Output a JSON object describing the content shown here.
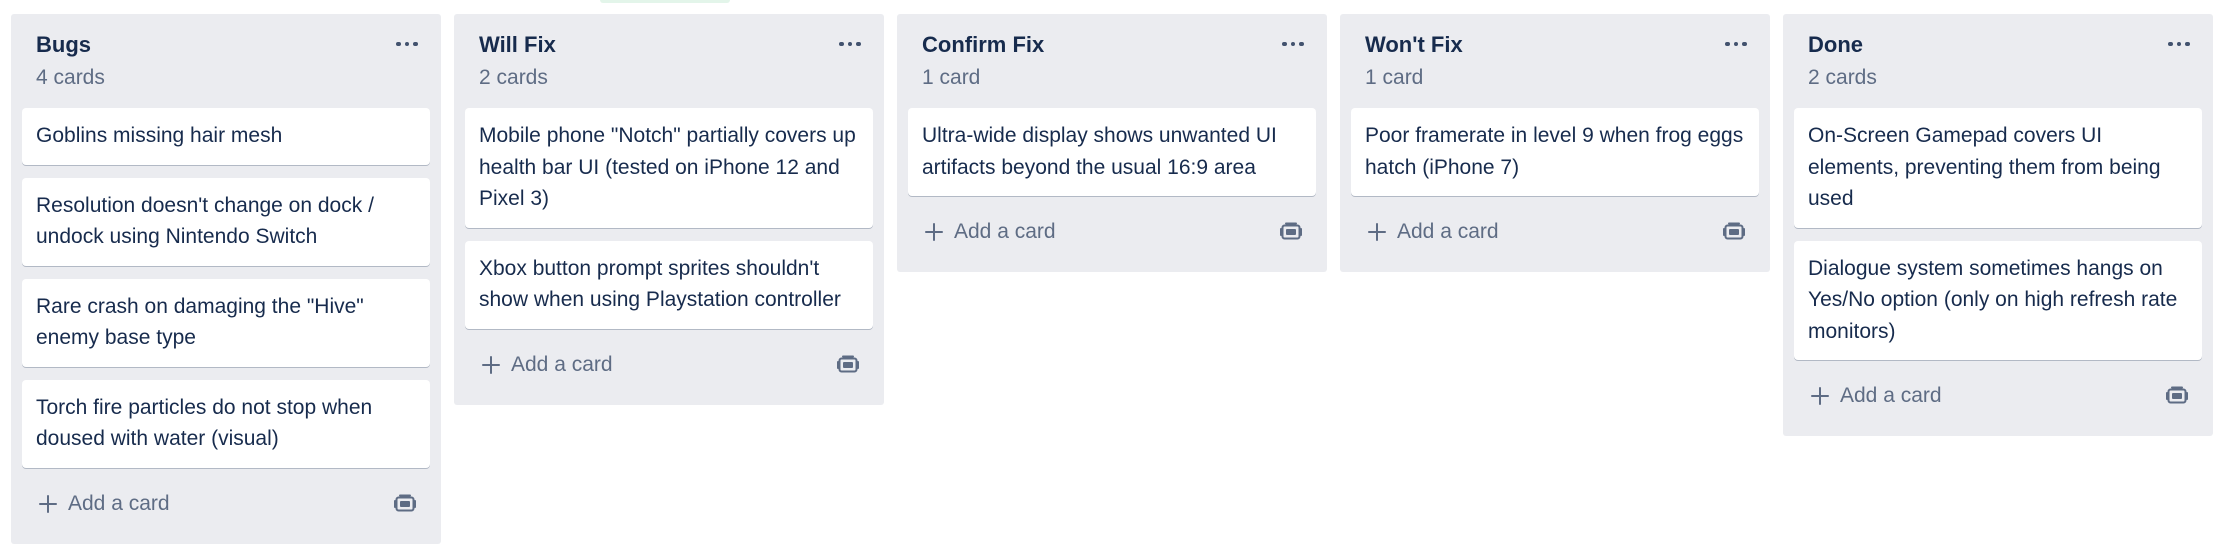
{
  "lists": [
    {
      "title": "Bugs",
      "count": "4 cards",
      "cards": [
        "Goblins missing hair mesh",
        "Resolution doesn't change on dock / undock using Nintendo Switch",
        "Rare crash on damaging the \"Hive\" enemy base type",
        "Torch fire particles do not stop when doused with water (visual)"
      ],
      "add_label": "Add a card"
    },
    {
      "title": "Will Fix",
      "count": "2 cards",
      "cards": [
        "Mobile phone \"Notch\" partially covers up health bar UI (tested on iPhone 12 and Pixel 3)",
        "Xbox button prompt sprites shouldn't show when using Playstation controller"
      ],
      "add_label": "Add a card"
    },
    {
      "title": "Confirm Fix",
      "count": "1 card",
      "cards": [
        "Ultra-wide display shows unwanted UI artifacts beyond the usual 16:9 area"
      ],
      "add_label": "Add a card"
    },
    {
      "title": "Won't Fix",
      "count": "1 card",
      "cards": [
        "Poor framerate in level 9 when frog eggs hatch (iPhone 7)"
      ],
      "add_label": "Add a card"
    },
    {
      "title": "Done",
      "count": "2 cards",
      "cards": [
        "On-Screen Gamepad covers UI elements, preventing them from being used",
        "Dialogue system sometimes hangs on Yes/No option (only on high refresh rate monitors)"
      ],
      "add_label": "Add a card"
    }
  ],
  "icons": {
    "list_menu": "ellipsis-icon",
    "add": "plus-icon",
    "template": "card-template-icon"
  },
  "colors": {
    "list_background": "#ebecf0",
    "card_background": "#ffffff",
    "text_primary": "#172b4d",
    "text_secondary": "#5e6c84"
  }
}
